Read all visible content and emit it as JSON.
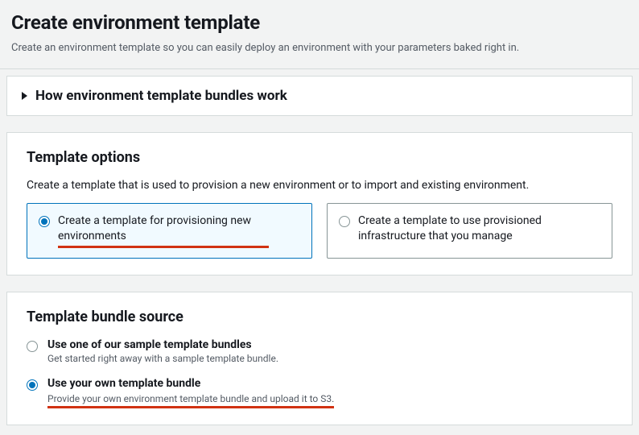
{
  "header": {
    "title": "Create environment template",
    "subtitle": "Create an environment template so you can easily deploy an environment with your parameters baked right in."
  },
  "expander": {
    "title": "How environment template bundles work"
  },
  "template_options": {
    "title": "Template options",
    "description": "Create a template that is used to provision a new environment or to import and existing environment.",
    "options": [
      {
        "label": "Create a template for provisioning new environments",
        "selected": true
      },
      {
        "label": "Create a template to use provisioned infrastructure that you manage",
        "selected": false
      }
    ]
  },
  "bundle_source": {
    "title": "Template bundle source",
    "options": [
      {
        "label": "Use one of our sample template bundles",
        "hint": "Get started right away with a sample template bundle.",
        "selected": false
      },
      {
        "label": "Use your own template bundle",
        "hint": "Provide your own environment template bundle and upload it to S3.",
        "selected": true
      }
    ]
  }
}
